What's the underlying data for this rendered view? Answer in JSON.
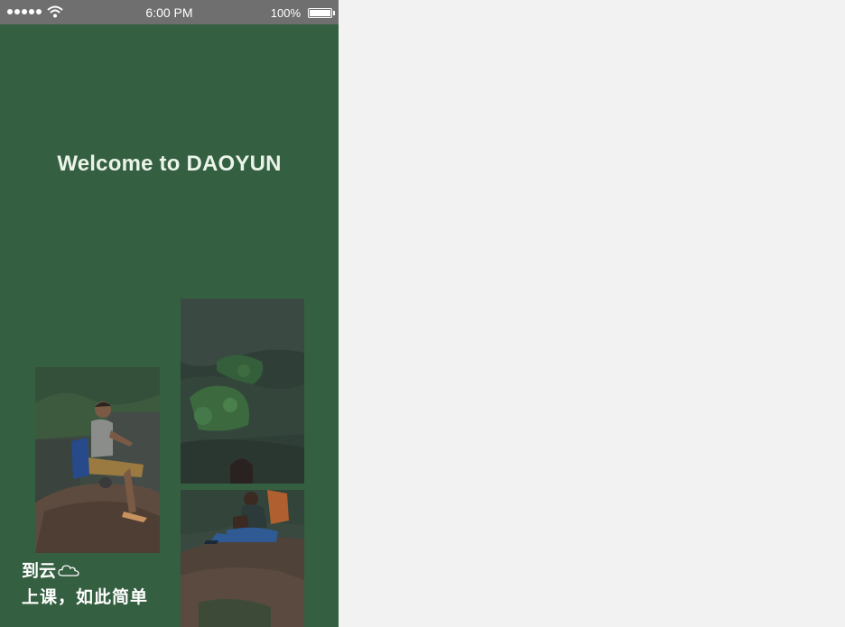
{
  "statusbar": {
    "time": "6:00 PM",
    "battery": "100%",
    "signal_icon": "signal-dots-icon",
    "wifi_icon": "wifi-icon",
    "battery_icon": "battery-icon"
  },
  "main": {
    "welcome": "Welcome to DAOYUN",
    "slogan_title": "到云",
    "slogan_sub": "上课，如此简单",
    "cloud_icon": "cloud-icon"
  },
  "colors": {
    "background": "#355f41",
    "statusbar": "#6f6f6f",
    "outer": "#f2f2f2"
  }
}
